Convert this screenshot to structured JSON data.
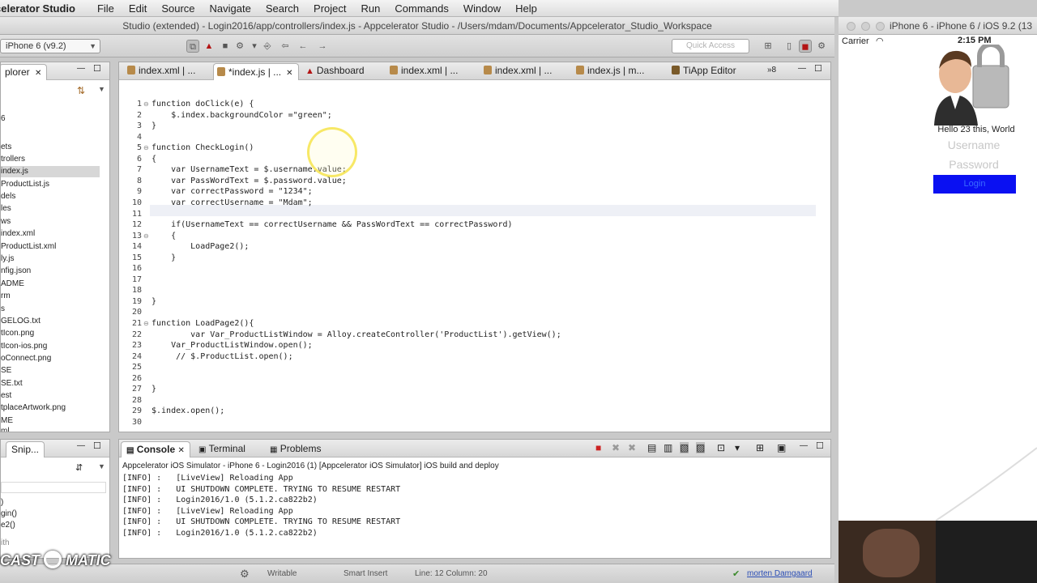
{
  "menubar": {
    "app_name": "celerator Studio",
    "items": [
      "File",
      "Edit",
      "Source",
      "Navigate",
      "Search",
      "Project",
      "Run",
      "Commands",
      "Window",
      "Help"
    ]
  },
  "window_title": "Studio (extended) - Login2016/app/controllers/index.js - Appcelerator Studio - /Users/mdam/Documents/Appcelerator_Studio_Workspace",
  "toolbar": {
    "target_device": "iPhone 6 (v9.2)",
    "quick_access_placeholder": "Quick Access"
  },
  "explorer": {
    "tab_label": "plorer",
    "items": [
      "6",
      "ets",
      "trollers",
      "index.js",
      "ProductList.js",
      "dels",
      "les",
      "ws",
      "index.xml",
      "ProductList.xml",
      "ly.js",
      "nfig.json",
      "ADME",
      "rm",
      "s",
      "GELOG.txt",
      "tIcon.png",
      "tIcon-ios.png",
      "oConnect.png",
      "SE",
      "SE.txt",
      "est",
      "tplaceArtwork.png",
      "ME",
      "ml"
    ],
    "selected_index": 3
  },
  "snippets": {
    "tab_label": "Snip...",
    "items": [
      ")",
      "gin()",
      "e2()",
      "ith"
    ]
  },
  "editor": {
    "tabs": [
      {
        "label": "index.xml | ...",
        "icon": "file-icon"
      },
      {
        "label": "*index.js | ...",
        "icon": "file-icon",
        "active": true
      },
      {
        "label": "Dashboard",
        "icon": "appcelerator-icon"
      },
      {
        "label": "index.xml | ...",
        "icon": "file-icon"
      },
      {
        "label": "index.xml | ...",
        "icon": "file-icon"
      },
      {
        "label": "index.js | m...",
        "icon": "file-icon"
      },
      {
        "label": "TiApp Editor",
        "icon": "tiapp-icon"
      },
      {
        "label": "»8",
        "icon": ""
      }
    ],
    "current_line": 12,
    "lines": [
      "function doClick(e) {",
      "    $.index.backgroundColor =\"green\";",
      "}",
      "",
      "function CheckLogin()",
      "{",
      "    var UsernameText = $.username.value;",
      "    var PassWordText = $.password.value;",
      "    var correctPassword = \"1234\";",
      "    var correctUsername = \"Mdam\";",
      "",
      "    if(UsernameText == correctUsername && PassWordText == correctPassword)",
      "    {",
      "        LoadPage2();",
      "    }",
      "",
      "",
      "",
      "}",
      "",
      "function LoadPage2(){",
      "        var Var_ProductListWindow = Alloy.createController('ProductList').getView();",
      "    Var_ProductListWindow.open();",
      "     // $.ProductList.open();",
      "",
      "",
      "}",
      "",
      "$.index.open();",
      ""
    ]
  },
  "console": {
    "tabs": [
      "Console",
      "Terminal",
      "Problems"
    ],
    "header": "Appcelerator iOS Simulator - iPhone 6 - Login2016 (1) [Appcelerator iOS Simulator] iOS build and deploy",
    "lines": [
      "[INFO] :   [LiveView] Reloading App",
      "[INFO] :   UI SHUTDOWN COMPLETE. TRYING TO RESUME RESTART",
      "[INFO] :   Login2016/1.0 (5.1.2.ca822b2)",
      "[INFO] :   [LiveView] Reloading App",
      "[INFO] :   UI SHUTDOWN COMPLETE. TRYING TO RESUME RESTART",
      "[INFO] :   Login2016/1.0 (5.1.2.ca822b2)"
    ]
  },
  "statusbar": {
    "writable": "Writable",
    "insert_mode": "Smart Insert",
    "position": "Line: 12 Column: 20",
    "user": "morten Damgaard"
  },
  "simulator": {
    "title": "iPhone 6 - iPhone 6 / iOS 9.2 (13",
    "carrier": "Carrier",
    "time": "2:15 PM",
    "greeting": "Hello 23 this, World",
    "username_placeholder": "Username",
    "password_placeholder": "Password",
    "login_label": "Login"
  },
  "watermark": {
    "left": "CAST",
    "right": "MATIC"
  },
  "colors": {
    "login_button": "#0a10f2",
    "keyword": "#7f0055",
    "string": "#2a00ff"
  }
}
